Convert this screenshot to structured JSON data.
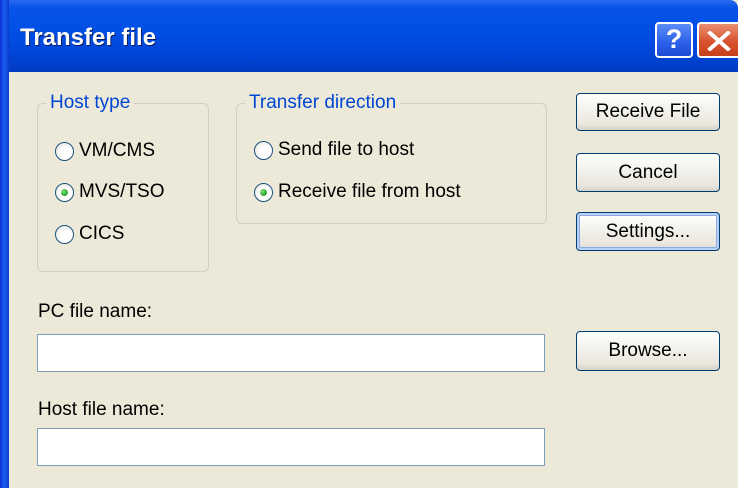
{
  "window": {
    "title": "Transfer file",
    "help_glyph": "?",
    "close_glyph": "close-x"
  },
  "host_type": {
    "legend": "Host type",
    "options": [
      {
        "label": "VM/CMS",
        "selected": false
      },
      {
        "label": "MVS/TSO",
        "selected": true
      },
      {
        "label": "CICS",
        "selected": false
      }
    ]
  },
  "transfer_direction": {
    "legend": "Transfer direction",
    "options": [
      {
        "label": "Send file to host",
        "selected": false
      },
      {
        "label": "Receive file from host",
        "selected": true
      }
    ]
  },
  "buttons": {
    "receive": "Receive File",
    "cancel": "Cancel",
    "settings": "Settings...",
    "browse": "Browse..."
  },
  "pc_file": {
    "label": "PC file name:",
    "value": ""
  },
  "host_file": {
    "label": "Host file name:",
    "value": ""
  },
  "colors": {
    "titlebar": "#0050E6",
    "dialog_bg": "#ECE9D8",
    "legend_text": "#0046D5",
    "close_button": "#D8532F",
    "radio_selected": "#21A121"
  }
}
